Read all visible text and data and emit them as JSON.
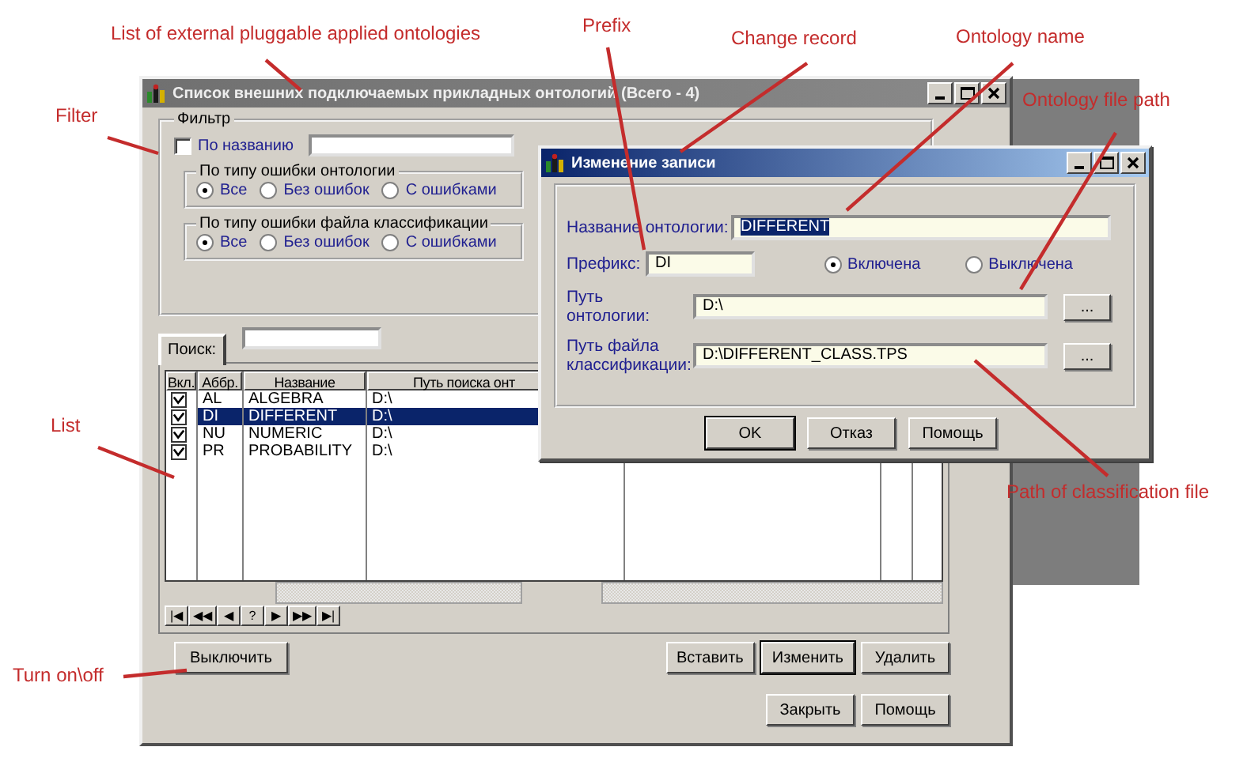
{
  "annotations": [
    {
      "text": "List of external pluggable applied ontologies"
    },
    {
      "text": "Prefix"
    },
    {
      "text": "Change record"
    },
    {
      "text": "Ontology name"
    },
    {
      "text": "Ontology file path"
    },
    {
      "text": "Filter"
    },
    {
      "text": "List"
    },
    {
      "text": "Turn on\\off"
    },
    {
      "text": "Path of classification file"
    }
  ],
  "main_window": {
    "title": "Список внешних подключаемых прикладных онтологий (Всего - 4)",
    "filter": {
      "legend": "Фильтр",
      "by_name": {
        "label": "По названию",
        "checked": false
      },
      "groups": [
        {
          "legend": "По типу ошибки онтологии",
          "options": [
            {
              "label": "Все",
              "selected": true
            },
            {
              "label": "Без ошибок",
              "selected": false
            },
            {
              "label": "С ошибками",
              "selected": false
            }
          ]
        },
        {
          "legend": "По типу ошибки файла классификации",
          "options": [
            {
              "label": "Все",
              "selected": true
            },
            {
              "label": "Без ошибок",
              "selected": false
            },
            {
              "label": "С ошибками",
              "selected": false
            }
          ]
        }
      ]
    },
    "search": {
      "tab": "Поиск:"
    },
    "table": {
      "columns": [
        "Вкл.",
        "Аббр.",
        "Название",
        "Путь поиска онт"
      ],
      "rows": [
        {
          "on": true,
          "abbr": "AL",
          "name": "ALGEBRA",
          "path": "D:\\",
          "selected": false
        },
        {
          "on": true,
          "abbr": "DI",
          "name": "DIFFERENT",
          "path": "D:\\",
          "selected": true
        },
        {
          "on": true,
          "abbr": "NU",
          "name": "NUMERIC",
          "path": "D:\\",
          "selected": false
        },
        {
          "on": true,
          "abbr": "PR",
          "name": "PROBABILITY",
          "path": "D:\\",
          "selected": false
        }
      ]
    },
    "navigator": [
      "|◀",
      "◀◀",
      "◀",
      "?",
      "▶",
      "▶▶",
      "▶|"
    ],
    "toggle_button": "Выключить",
    "list_buttons": [
      {
        "label": "Вставить",
        "default": false
      },
      {
        "label": "Изменить",
        "default": true
      },
      {
        "label": "Удалить",
        "default": false
      }
    ],
    "footer_buttons": [
      "Закрыть",
      "Помощь"
    ]
  },
  "dialog": {
    "title": "Изменение записи",
    "name": {
      "label": "Название онтологии:",
      "value": "DIFFERENT",
      "text_selected": true
    },
    "prefix": {
      "label": "Префикс:",
      "value": "DI"
    },
    "status": [
      {
        "label": "Включена",
        "selected": true
      },
      {
        "label": "Выключена",
        "selected": false
      }
    ],
    "paths": [
      {
        "label": "Путь онтологии:",
        "value": "D:\\",
        "button": "..."
      },
      {
        "label": "Путь файла классификации:",
        "value": "D:\\DIFFERENT_CLASS.TPS",
        "button": "..."
      }
    ],
    "buttons": [
      {
        "label": "OK",
        "default": true
      },
      {
        "label": "Отказ",
        "default": false
      },
      {
        "label": "Помощь",
        "default": false
      }
    ]
  }
}
